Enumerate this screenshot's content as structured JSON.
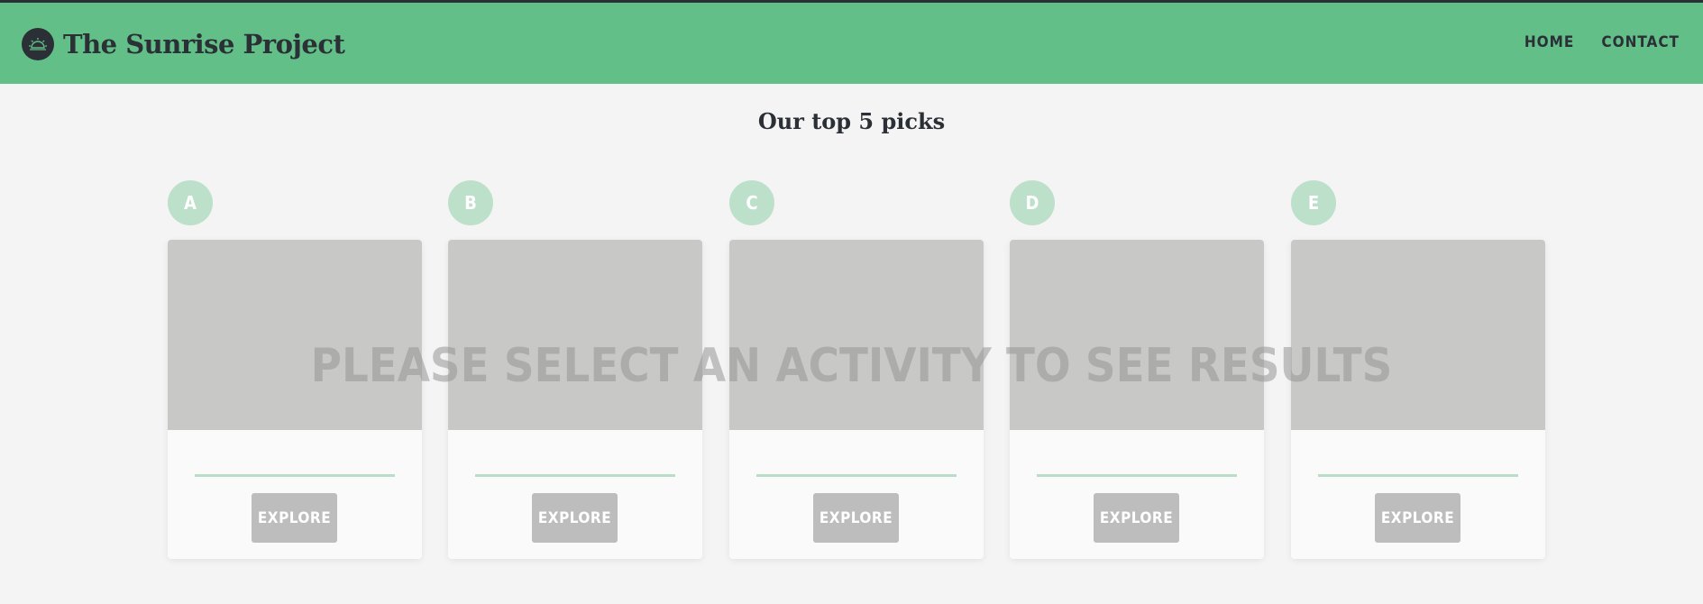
{
  "header": {
    "brand_title": "The Sunrise Project",
    "logo_icon": "sunrise-icon",
    "nav": [
      {
        "label": "HOME"
      },
      {
        "label": "CONTACT"
      }
    ]
  },
  "main": {
    "section_title": "Our top 5 picks",
    "overlay_message": "PLEASE SELECT AN ACTIVITY TO SEE RESULTS",
    "cards": [
      {
        "letter": "A",
        "button_label": "EXPLORE"
      },
      {
        "letter": "B",
        "button_label": "EXPLORE"
      },
      {
        "letter": "C",
        "button_label": "EXPLORE"
      },
      {
        "letter": "D",
        "button_label": "EXPLORE"
      },
      {
        "letter": "E",
        "button_label": "EXPLORE"
      }
    ]
  },
  "colors": {
    "header_bg": "#62bf88",
    "dark": "#2b2f36",
    "badge_bg": "#bde0cb",
    "placeholder": "#c8c8c6",
    "button_bg": "#bdbdbd"
  }
}
